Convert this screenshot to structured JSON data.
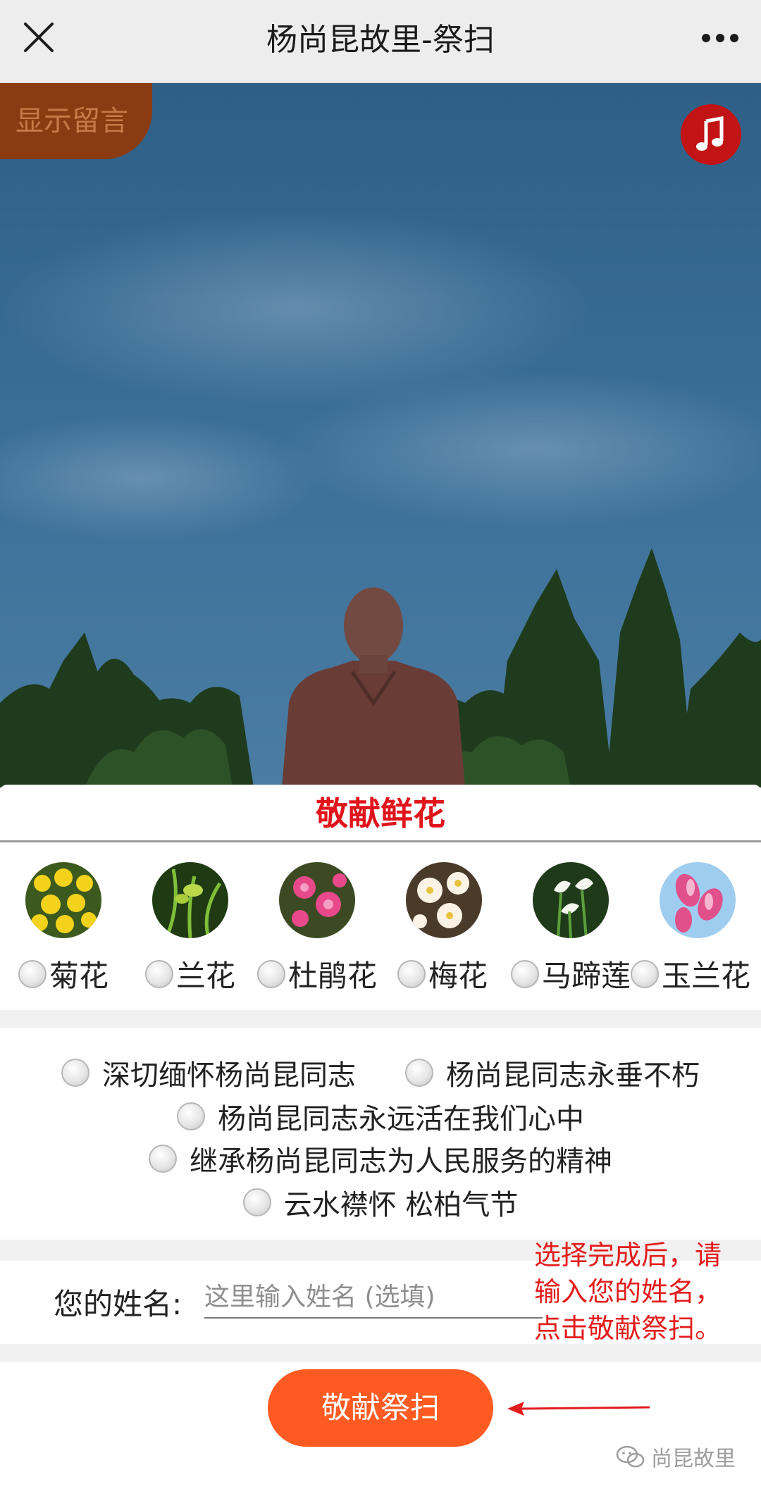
{
  "titlebar": {
    "title": "杨尚昆故里-祭扫",
    "close_icon": "close-icon",
    "more_icon": "more-icon"
  },
  "hero": {
    "show_messages_label": "显示留言",
    "music_icon": "music-note-icon"
  },
  "flowers": {
    "title": "敬献鲜花",
    "items": [
      {
        "label": "菊花"
      },
      {
        "label": "兰花"
      },
      {
        "label": "杜鹃花"
      },
      {
        "label": "梅花"
      },
      {
        "label": "马蹄莲"
      },
      {
        "label": "玉兰花"
      }
    ]
  },
  "wishes": {
    "items": [
      {
        "label": "深切缅怀杨尚昆同志"
      },
      {
        "label": "杨尚昆同志永垂不朽"
      },
      {
        "label": "杨尚昆同志永远活在我们心中"
      },
      {
        "label": "继承杨尚昆同志为人民服务的精神"
      },
      {
        "label": "云水襟怀 松柏气节"
      }
    ]
  },
  "name": {
    "label": "您的姓名:",
    "placeholder": "这里输入姓名 (选填)",
    "value": ""
  },
  "submit": {
    "label": "敬献祭扫"
  },
  "annotation": {
    "line1": "选择完成后，请",
    "line2": "输入您的姓名，",
    "line3": "点击敬献祭扫。"
  },
  "watermark": {
    "text": "尚昆故里"
  },
  "colors": {
    "accent": "#fe5a22",
    "title_red": "#e0141b",
    "music_button": "#c21414",
    "annotation_red": "#e31c1c"
  }
}
